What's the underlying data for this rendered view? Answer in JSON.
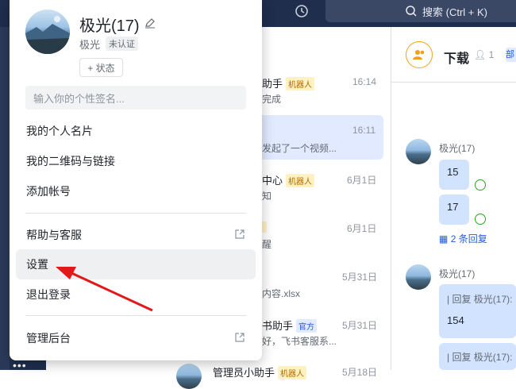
{
  "topbar": {
    "history_icon": "history-icon",
    "search_label": "搜索 (Ctrl + K)"
  },
  "profile": {
    "name": "极光(17)",
    "org": "极光",
    "verify_badge": "未认证",
    "status_button": "+ 状态",
    "signature_placeholder": "输入你的个性签名..."
  },
  "menu": {
    "items": [
      {
        "label": "我的个人名片"
      },
      {
        "label": "我的二维码与链接"
      },
      {
        "label": "添加帐号"
      },
      {
        "label": "帮助与客服"
      },
      {
        "label": "设置"
      },
      {
        "label": "退出登录"
      },
      {
        "label": "管理后台"
      }
    ]
  },
  "chats": [
    {
      "title": "助手",
      "tag": "机器人",
      "time": "16:14",
      "sub": "完成"
    },
    {
      "title": "",
      "tag": "",
      "time": "16:11",
      "sub": "发起了一个视频..."
    },
    {
      "title": "中心",
      "tag": "机器人",
      "time": "6月1日",
      "sub": "知"
    },
    {
      "title": "",
      "tag": "",
      "time": "6月1日",
      "sub": "醒"
    },
    {
      "title": "",
      "tag": "",
      "time": "5月31日",
      "sub": "内容.xlsx"
    },
    {
      "title": "书助手",
      "tag": "官方",
      "time": "5月31日",
      "sub": "好，飞书客服系..."
    },
    {
      "title": "管理员小助手",
      "tag": "机器人",
      "time": "5月18日",
      "sub": ""
    }
  ],
  "conversation": {
    "title": "下载",
    "member_count": "1",
    "tab_fragment": "部",
    "messages": [
      {
        "sender": "极光(17)",
        "bubbles": [
          "15",
          "17"
        ],
        "replies": "2 条回复"
      },
      {
        "sender": "极光(17)",
        "quotes": [
          "回复 极光(17):",
          "回复 极光(17):"
        ],
        "body": "154"
      }
    ]
  },
  "left_rail": {
    "fragments": [
      "视",
      "参"
    ],
    "more": "•••"
  }
}
